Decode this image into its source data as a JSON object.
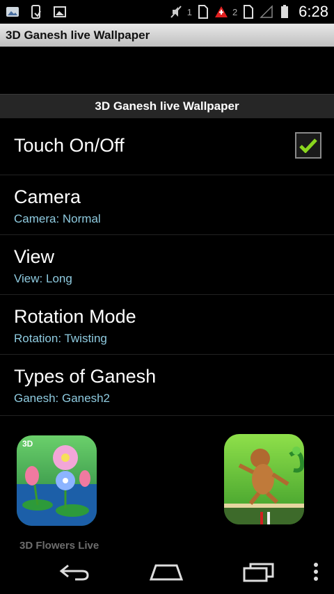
{
  "status_bar": {
    "sim1": "1",
    "sim2": "2",
    "time": "6:28"
  },
  "app_title": "3D Ganesh live Wallpaper",
  "section_header": "3D Ganesh live Wallpaper",
  "preferences": [
    {
      "title": "Touch On/Off",
      "summary": "",
      "checked": true
    },
    {
      "title": "Camera",
      "summary": "Camera: Normal"
    },
    {
      "title": "View",
      "summary": "View: Long"
    },
    {
      "title": "Rotation Mode",
      "summary": "Rotation: Twisting"
    },
    {
      "title": "Types of Ganesh",
      "summary": "Ganesh: Ganesh2"
    }
  ],
  "ads": [
    {
      "label": "3D Flowers Live",
      "icon": "flowers-app-icon"
    },
    {
      "label": "",
      "icon": "monkey-game-app-icon"
    }
  ],
  "nav": {
    "back_icon": "back-icon",
    "home_icon": "home-icon",
    "recents_icon": "recents-icon",
    "menu_icon": "overflow-menu-icon"
  },
  "colors": {
    "summary": "#8fcbe0",
    "check": "#8ad61e",
    "title_bar": "#d6d6d6"
  }
}
